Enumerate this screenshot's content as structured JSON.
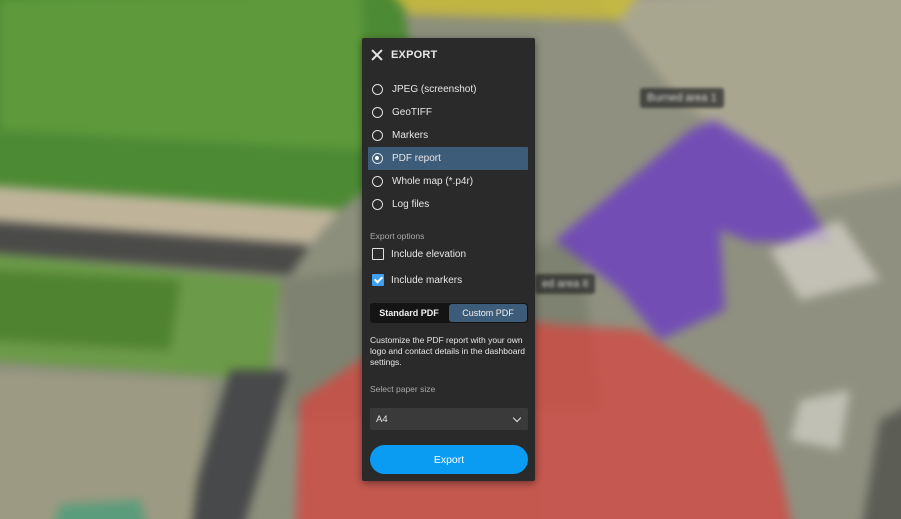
{
  "map": {
    "zone_labels": [
      "Burned area 1",
      "ed area II"
    ]
  },
  "panel": {
    "title": "EXPORT",
    "formats": [
      {
        "label": "JPEG (screenshot)",
        "selected": false
      },
      {
        "label": "GeoTIFF",
        "selected": false
      },
      {
        "label": "Markers",
        "selected": false
      },
      {
        "label": "PDF report",
        "selected": true
      },
      {
        "label": "Whole map (*.p4r)",
        "selected": false
      },
      {
        "label": "Log files",
        "selected": false
      }
    ],
    "options_label": "Export options",
    "options": [
      {
        "label": "Include elevation",
        "checked": false
      },
      {
        "label": "Include markers",
        "checked": true
      }
    ],
    "pdf_types": [
      {
        "label": "Standard PDF",
        "active": false
      },
      {
        "label": "Custom PDF",
        "active": true
      }
    ],
    "description": "Customize the PDF report with your own logo and contact details in the dashboard settings.",
    "paper_label": "Select paper size",
    "paper_value": "A4",
    "export_label": "Export"
  },
  "colors": {
    "panel_bg": "#2a2a2a",
    "selected_bg": "#3d5c7a",
    "accent": "#0a9bf2",
    "checkbox": "#3fa0ee"
  }
}
